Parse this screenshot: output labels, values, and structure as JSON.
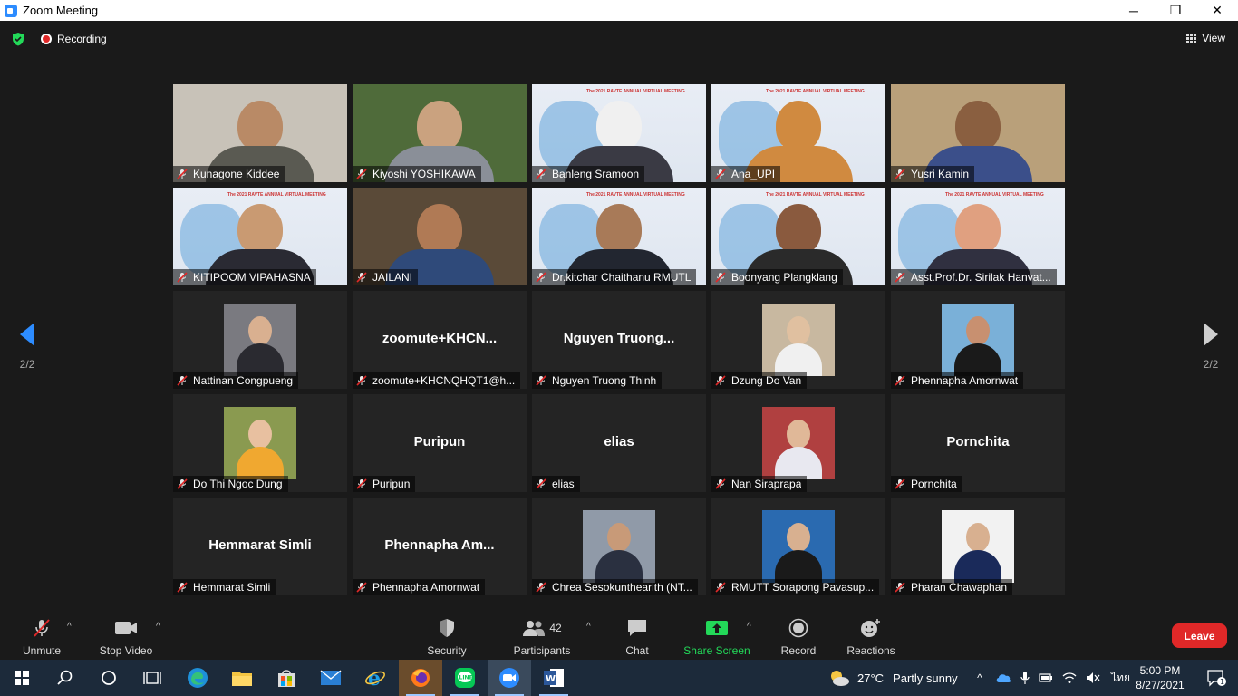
{
  "window": {
    "title": "Zoom Meeting",
    "min": "─",
    "max": "❐",
    "close": "✕"
  },
  "topbar": {
    "recording_label": "Recording",
    "view_label": "View"
  },
  "nav": {
    "page_left": "2/2",
    "page_right": "2/2"
  },
  "tiles": [
    {
      "name": "Kunagone Kiddee",
      "kind": "video",
      "bg": "#c8c2b8",
      "skin": "#b98a66",
      "shirt": "#5a5a52"
    },
    {
      "name": "Kiyoshi YOSHIKAWA",
      "kind": "video",
      "bg": "#4f6b3a",
      "skin": "#caa27f",
      "shirt": "#8a8f98"
    },
    {
      "name": "Banleng Sramoon",
      "kind": "slide",
      "skin": "#f0f0f0",
      "shirt": "#3a3a44",
      "slide_text": "The 2021 RAVTE ANNUAL VIRTUAL MEETING"
    },
    {
      "name": "Ana_UPI",
      "kind": "slide",
      "skin": "#d08a40",
      "shirt": "#d08a40",
      "slide_text": "The 2021 RAVTE ANNUAL VIRTUAL MEETING"
    },
    {
      "name": "Yusri Kamin",
      "kind": "video",
      "bg": "#b9a07a",
      "skin": "#8a5f40",
      "shirt": "#3b4f8a"
    },
    {
      "name": "KITIPOOM VIPAHASNA",
      "kind": "slide",
      "skin": "#c99a72",
      "shirt": "#2a2a33",
      "slide_text": "The 2021 RAVTE ANNUAL VIRTUAL MEETING"
    },
    {
      "name": "JAILANI",
      "kind": "video",
      "bg": "#5a4a38",
      "skin": "#b07a55",
      "shirt": "#2f4a7a"
    },
    {
      "name": "Dr.kitchar Chaithanu RMUTL",
      "kind": "slide",
      "skin": "#a87a58",
      "shirt": "#222630",
      "slide_text": "The 2021 RAVTE ANNUAL VIRTUAL MEETING"
    },
    {
      "name": "Boonyang Plangklang",
      "kind": "slide",
      "skin": "#8a5a3e",
      "shirt": "#2a2a2a",
      "slide_text": "The 2021 RAVTE ANNUAL VIRTUAL MEETING"
    },
    {
      "name": "Asst.Prof.Dr. Sirilak Hanvat...",
      "kind": "slide",
      "skin": "#e0a080",
      "shirt": "#303040",
      "slide_text": "The 2021 RAVTE ANNUAL VIRTUAL MEETING"
    },
    {
      "name": "Nattinan Congpueng",
      "kind": "photo",
      "bg": "#7a7a80",
      "skin": "#d9b090",
      "shirt": "#2a2a30"
    },
    {
      "name": "zoomute+KHCNQHQT1@h...",
      "kind": "name",
      "big": "zoomute+KHCN..."
    },
    {
      "name": "Nguyen Truong Thinh",
      "kind": "name",
      "big": "Nguyen  Truong..."
    },
    {
      "name": "Dzung Do Van",
      "kind": "photo",
      "bg": "#c8b8a0",
      "skin": "#e0c0a0",
      "shirt": "#f0f0f0"
    },
    {
      "name": "Phennapha Amornwat",
      "kind": "photo",
      "bg": "#7ab0d8",
      "skin": "#c89070",
      "shirt": "#1a1a1a"
    },
    {
      "name": "Do Thi Ngoc Dung",
      "kind": "photo",
      "bg": "#8a9a50",
      "skin": "#e8c0a0",
      "shirt": "#f0a830"
    },
    {
      "name": "Puripun",
      "kind": "name",
      "big": "Puripun"
    },
    {
      "name": "elias",
      "kind": "name",
      "big": "elias"
    },
    {
      "name": "Nan Siraprapa",
      "kind": "photo",
      "bg": "#b04040",
      "skin": "#e0b898",
      "shirt": "#e8e8f0"
    },
    {
      "name": "Pornchita",
      "kind": "name",
      "big": "Pornchita"
    },
    {
      "name": "Hemmarat Simli",
      "kind": "name",
      "big": "Hemmarat Simli"
    },
    {
      "name": "Phennapha Amornwat",
      "kind": "name",
      "big": "Phennapha  Am..."
    },
    {
      "name": "Chrea Sesokunthearith (NT...",
      "kind": "photo",
      "bg": "#909aa8",
      "skin": "#c89a78",
      "shirt": "#2a3040"
    },
    {
      "name": "RMUTT Sorapong Pavasup...",
      "kind": "photo",
      "bg": "#2a6ab0",
      "skin": "#d8b090",
      "shirt": "#1a1a1a"
    },
    {
      "name": "Pharan Chawaphan",
      "kind": "photo",
      "bg": "#f2f2f2",
      "skin": "#d8b090",
      "shirt": "#1a2a5a"
    }
  ],
  "toolbar": {
    "unmute": "Unmute",
    "stop_video": "Stop Video",
    "security": "Security",
    "participants": "Participants",
    "participants_count": "42",
    "chat": "Chat",
    "share_screen": "Share Screen",
    "record": "Record",
    "reactions": "Reactions",
    "leave": "Leave"
  },
  "taskbar": {
    "temperature": "27°C",
    "weather": "Partly sunny",
    "language": "ไทย",
    "time": "5:00 PM",
    "date": "8/27/2021",
    "notifications": "1"
  },
  "colors": {
    "accent_green": "#23d959",
    "leave_red": "#e02828",
    "zoom_blue": "#2d8cff"
  }
}
